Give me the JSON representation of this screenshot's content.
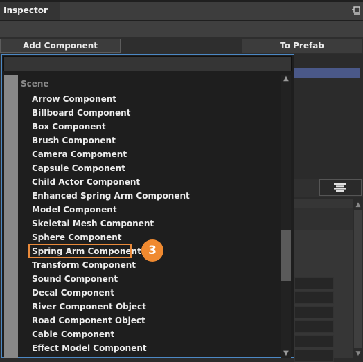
{
  "window": {
    "title": "Inspector"
  },
  "toolbar": {
    "add_component_label": "Add Component",
    "to_prefab_label": "To Prefab"
  },
  "popup": {
    "search_value": "",
    "category": "Scene",
    "items": [
      {
        "label": "Arrow Component"
      },
      {
        "label": "Billboard Component"
      },
      {
        "label": "Box Component"
      },
      {
        "label": "Brush Component"
      },
      {
        "label": "Camera Compoment"
      },
      {
        "label": "Capsule Component"
      },
      {
        "label": "Child Actor Component"
      },
      {
        "label": "Enhanced Spring Arm Component"
      },
      {
        "label": "Model Component"
      },
      {
        "label": "Skeletal Mesh Component"
      },
      {
        "label": "Sphere Component"
      },
      {
        "label": "Spring Arm Component",
        "highlighted": true
      },
      {
        "label": "Transform Component"
      },
      {
        "label": "Sound Component"
      },
      {
        "label": "Decal Component"
      },
      {
        "label": "River Component Object"
      },
      {
        "label": "Road Component Object"
      },
      {
        "label": "Cable Component"
      },
      {
        "label": "Effect Model Component"
      }
    ],
    "highlight_step": "3",
    "highlight_color": "#f08a30",
    "border_color": "#4c88c4"
  },
  "icons": {
    "pin": "pin-icon",
    "list_view": "list-view-icon",
    "scroll_up": "chevron-up-icon",
    "scroll_down": "chevron-down-icon"
  }
}
